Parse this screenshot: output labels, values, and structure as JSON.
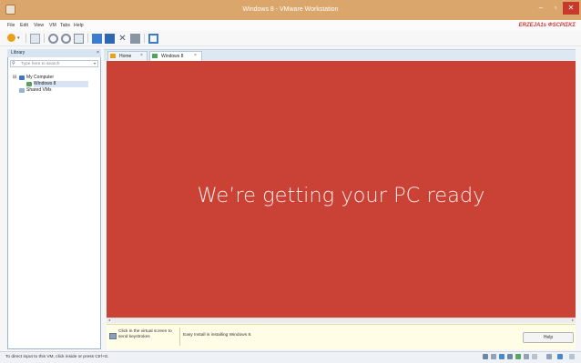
{
  "window": {
    "title": "Windows 8 - VMware Workstation"
  },
  "menu": [
    "File",
    "Edit",
    "View",
    "VM",
    "Tabs",
    "Help"
  ],
  "watermark": "ERZEJA1s ΦSCPΙΣΚΣ",
  "library": {
    "title": "Library",
    "close": "×",
    "search_placeholder": "Type here to search",
    "tree": [
      "My Computer",
      "Windows 8",
      "Shared VMs"
    ]
  },
  "tabs": [
    {
      "label": "Home",
      "close": "×"
    },
    {
      "label": "Windows 8",
      "close": "×"
    }
  ],
  "vm": {
    "message": "We’re getting your PC ready"
  },
  "hints": {
    "click": "Click in the virtual screen to send keystrokes",
    "install": "Easy Install is installing Windows 8.",
    "help": "Help"
  },
  "status": {
    "text": "To direct input to this VM, click inside or press Ctrl+G."
  },
  "colors": {
    "titlebar": "#dba66b",
    "vm_screen": "#c94235",
    "accent": "#3b7bd0"
  },
  "icons": [
    "app-icon",
    "minimize-icon",
    "maximize-icon",
    "close-icon",
    "power-icon",
    "search-icon",
    "computer-icon",
    "vm-icon",
    "shared-icon",
    "home-icon",
    "info-icon"
  ]
}
